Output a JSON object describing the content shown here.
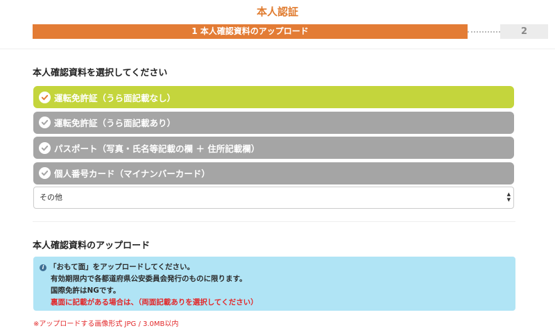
{
  "page": {
    "title": "本人認証"
  },
  "stepper": {
    "active_label": "1 本人確認資料のアップロード",
    "next_label": "2"
  },
  "section_select": {
    "heading": "本人確認資料を選択してください",
    "options": [
      {
        "label": "運転免許証（うら面記載なし）",
        "selected": true
      },
      {
        "label": "運転免許証（うら面記載あり）",
        "selected": false
      },
      {
        "label": "パスポート（写真・氏名等記載の欄 ＋ 住所記載欄）",
        "selected": false
      },
      {
        "label": "個人番号カード（マイナンバーカード）",
        "selected": false
      }
    ],
    "other_select": {
      "value": "その他"
    }
  },
  "section_upload": {
    "heading": "本人確認資料のアップロード",
    "info": {
      "line1": "「おもて面」をアップロードしてください。",
      "line2": "有効期限内で各都道府県公安委員会発行のものに限ります。",
      "line3": "国際免許はNGです。",
      "line4": "裏面に記載がある場合は、（両面記載ありを選択してください）"
    },
    "note": "※アップロードする画像形式 JPG / 3.0MB以内"
  },
  "colors": {
    "accent": "#e37c35",
    "selected_option": "#c4d53c",
    "unselected_option": "#a5a5a5",
    "info_bg": "#b0e4f5",
    "warning_text": "#e2282a"
  },
  "icons": {
    "option_check": "check-circle-icon",
    "info": "info-icon",
    "select": "select-arrows-icon"
  }
}
